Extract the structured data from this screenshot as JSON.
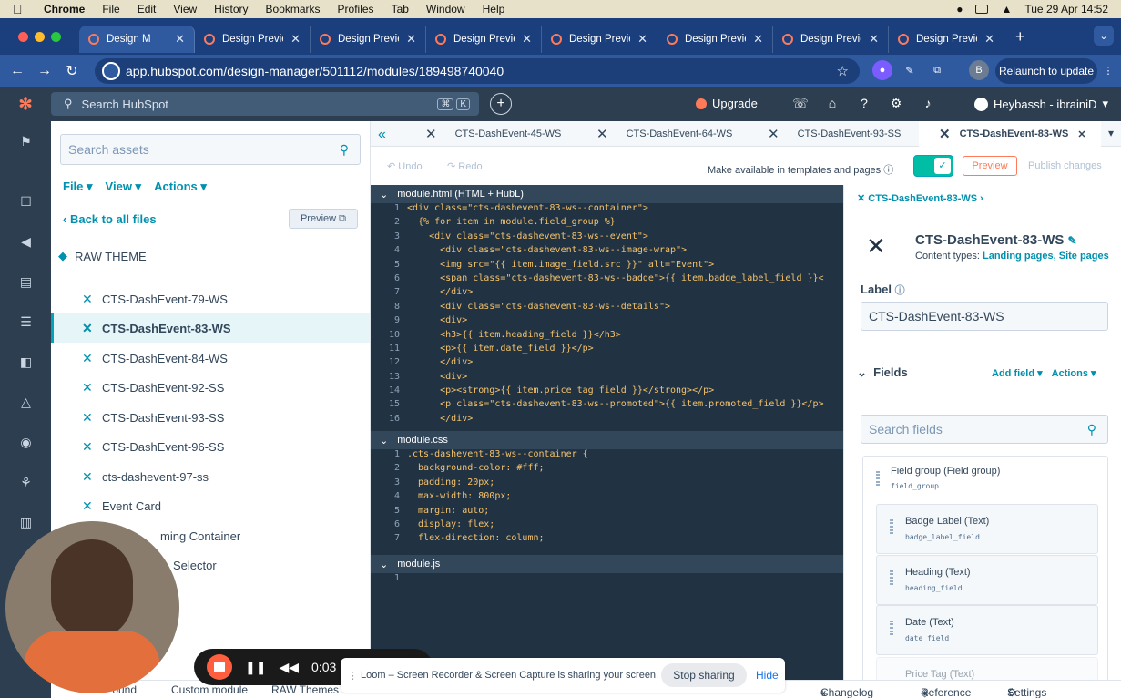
{
  "mac": {
    "menus": [
      "Chrome",
      "File",
      "Edit",
      "View",
      "History",
      "Bookmarks",
      "Profiles",
      "Tab",
      "Window",
      "Help"
    ],
    "clock": "Tue 29 Apr  14:52"
  },
  "browser": {
    "tabs": [
      {
        "title": "Design M",
        "active": true
      },
      {
        "title": "Design Previe",
        "active": false
      },
      {
        "title": "Design Previe",
        "active": false
      },
      {
        "title": "Design Previe",
        "active": false
      },
      {
        "title": "Design Previe",
        "active": false
      },
      {
        "title": "Design Previe",
        "active": false
      },
      {
        "title": "Design Previe",
        "active": false
      },
      {
        "title": "Design Previe",
        "active": false
      }
    ],
    "url": "app.hubspot.com/design-manager/501112/modules/189498740040",
    "relaunch": "Relaunch to update",
    "profile_initial": "B"
  },
  "hs": {
    "search_placeholder": "Search HubSpot",
    "kbd": [
      "⌘",
      "K"
    ],
    "upgrade": "Upgrade",
    "account": "Heybassh - ibrainiD"
  },
  "assets": {
    "search_placeholder": "Search assets",
    "menus": [
      "File ▾",
      "View ▾",
      "Actions ▾"
    ],
    "back": "Back to all files",
    "preview": "Preview",
    "theme": "RAW THEME",
    "files": [
      {
        "name": "CTS-DashEvent-79-WS",
        "selected": false
      },
      {
        "name": "CTS-DashEvent-83-WS",
        "selected": true
      },
      {
        "name": "CTS-DashEvent-84-WS",
        "selected": false
      },
      {
        "name": "CTS-DashEvent-92-SS",
        "selected": false
      },
      {
        "name": "CTS-DashEvent-93-SS",
        "selected": false
      },
      {
        "name": "CTS-DashEvent-96-SS",
        "selected": false
      },
      {
        "name": "cts-dashevent-97-ss",
        "selected": false
      },
      {
        "name": "Event Card",
        "selected": false
      },
      {
        "name": "ming Container",
        "selected": false
      },
      {
        "name": "Selector",
        "selected": false
      }
    ]
  },
  "editor": {
    "tabs": [
      {
        "title": "CTS-DashEvent-45-WS",
        "active": false
      },
      {
        "title": "CTS-DashEvent-64-WS",
        "active": false
      },
      {
        "title": "CTS-DashEvent-93-SS",
        "active": false
      },
      {
        "title": "CTS-DashEvent-83-WS",
        "active": true
      }
    ],
    "undo": "Undo",
    "redo": "Redo",
    "available": "Make available in templates and pages",
    "preview": "Preview",
    "publish": "Publish changes",
    "html_head": "module.html (HTML + HubL)",
    "html_lines": [
      "<div class=\"cts-dashevent-83-ws--container\">",
      "  {% for item in module.field_group %}",
      "    <div class=\"cts-dashevent-83-ws--event\">",
      "      <div class=\"cts-dashevent-83-ws--image-wrap\">",
      "      <img src=\"{{ item.image_field.src }}\" alt=\"Event\">",
      "      <span class=\"cts-dashevent-83-ws--badge\">{{ item.badge_label_field }}<",
      "      </div>",
      "      <div class=\"cts-dashevent-83-ws--details\">",
      "      <div>",
      "      <h3>{{ item.heading_field }}</h3>",
      "      <p>{{ item.date_field }}</p>",
      "      </div>",
      "      <div>",
      "      <p><strong>{{ item.price_tag_field }}</strong></p>",
      "      <p class=\"cts-dashevent-83-ws--promoted\">{{ item.promoted_field }}</p>",
      "      </div>"
    ],
    "css_head": "module.css",
    "css_lines": [
      ".cts-dashevent-83-ws--container {",
      "  background-color: #fff;",
      "  padding: 20px;",
      "  max-width: 800px;",
      "  margin: auto;",
      "  display: flex;",
      "  flex-direction: column;"
    ],
    "js_head": "module.js",
    "js_lines": [
      "1"
    ]
  },
  "inspector": {
    "breadcrumb": "CTS-DashEvent-83-WS ›",
    "title": "CTS-DashEvent-83-WS",
    "content_types_label": "Content types:",
    "content_types": "Landing pages, Site pages",
    "label_heading": "Label",
    "label_value": "CTS-DashEvent-83-WS",
    "fields_heading": "Fields",
    "add_field": "Add field ▾",
    "actions": "Actions ▾",
    "search_fields": "Search fields",
    "group_name": "Field group (Field group)",
    "group_key": "field_group",
    "fields": [
      {
        "name": "Badge Label (Text)",
        "key": "badge_label_field"
      },
      {
        "name": "Heading (Text)",
        "key": "heading_field"
      },
      {
        "name": "Date (Text)",
        "key": "date_field"
      },
      {
        "name": "Price Tag (Text)",
        "key": ""
      }
    ]
  },
  "bottombar": {
    "items": [
      "Found",
      "Custom module",
      "RAW Themes",
      "Changelog",
      "Reference",
      "Settings"
    ]
  },
  "loom": {
    "message": "Loom – Screen Recorder & Screen Capture is sharing your screen.",
    "stop": "Stop sharing",
    "hide": "Hide",
    "time": "0:03"
  },
  "colors": {
    "hubspot_orange": "#ff7a59",
    "teal": "#00a4bd",
    "navy": "#2d3e50"
  }
}
